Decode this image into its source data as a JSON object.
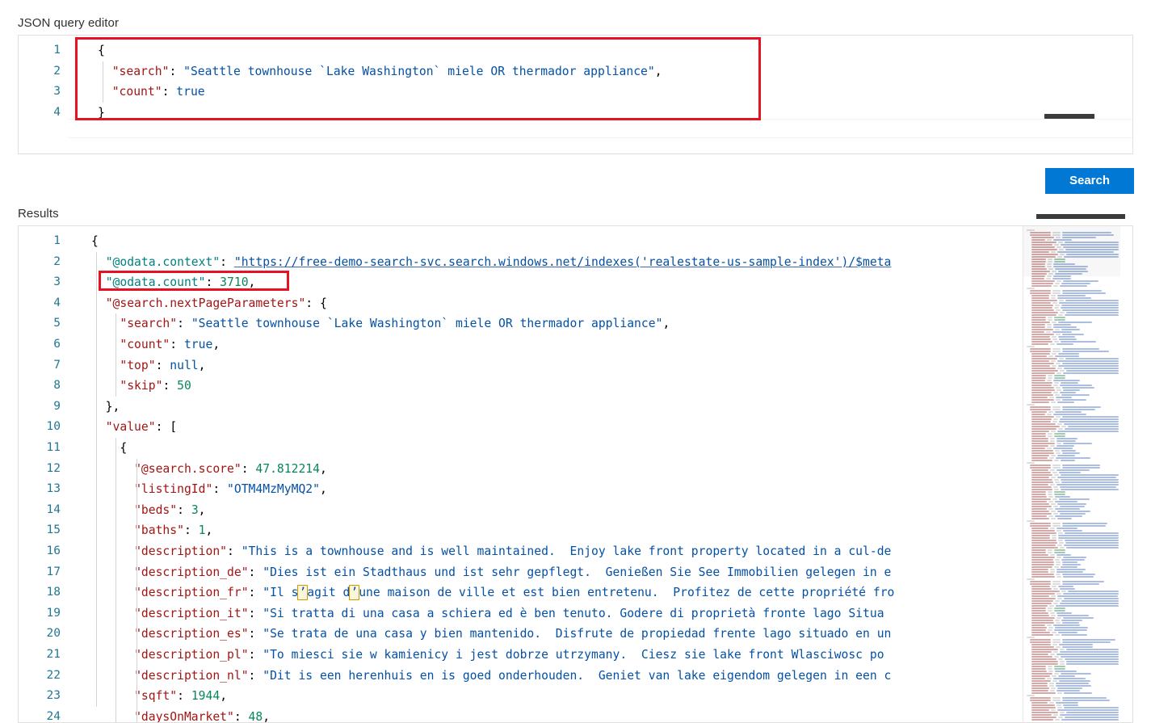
{
  "labels": {
    "json_query_editor": "JSON query editor",
    "results": "Results"
  },
  "actions": {
    "search_button": "Search"
  },
  "colors": {
    "accent": "#0078d4",
    "annotation": "#e81123",
    "line_number": "#237893",
    "json_key": "#a31515",
    "json_string": "#0451a5",
    "json_number": "#098658",
    "json_odata_key": "#008080"
  },
  "query_editor": {
    "line_numbers": [
      "1",
      "2",
      "3",
      "4"
    ],
    "lines": [
      [
        {
          "text": "{",
          "cls": "t-punc"
        }
      ],
      [
        {
          "text": "  ",
          "cls": "t-punc"
        },
        {
          "text": "\"search\"",
          "cls": "t-key"
        },
        {
          "text": ": ",
          "cls": "t-punc"
        },
        {
          "text": "\"Seattle townhouse `Lake Washington` miele OR thermador appliance\"",
          "cls": "t-str"
        },
        {
          "text": ",",
          "cls": "t-punc"
        }
      ],
      [
        {
          "text": "  ",
          "cls": "t-punc"
        },
        {
          "text": "\"count\"",
          "cls": "t-key"
        },
        {
          "text": ": ",
          "cls": "t-punc"
        },
        {
          "text": "true",
          "cls": "t-kw"
        }
      ],
      [
        {
          "text": "}",
          "cls": "t-punc"
        }
      ]
    ],
    "search_value": "Seattle townhouse `Lake Washington` miele OR thermador appliance",
    "count_value": "true"
  },
  "results_editor": {
    "line_numbers": [
      "1",
      "2",
      "3",
      "4",
      "5",
      "6",
      "7",
      "8",
      "9",
      "10",
      "11",
      "12",
      "13",
      "14",
      "15",
      "16",
      "17",
      "18",
      "19",
      "20",
      "21",
      "22",
      "23",
      "24"
    ],
    "lines": [
      [
        {
          "text": "{",
          "cls": "t-punc"
        }
      ],
      [
        {
          "text": "  ",
          "cls": "t-punc"
        },
        {
          "text": "\"@odata.context\"",
          "cls": "t-teal"
        },
        {
          "text": ": ",
          "cls": "t-punc"
        },
        {
          "text": "\"https://free-demo-search-svc.search.windows.net/indexes('realestate-us-sample-index')/$meta",
          "cls": "t-link"
        }
      ],
      [
        {
          "text": "  ",
          "cls": "t-punc"
        },
        {
          "text": "\"@odata.count\"",
          "cls": "t-teal"
        },
        {
          "text": ": ",
          "cls": "t-punc"
        },
        {
          "text": "3710",
          "cls": "t-num"
        },
        {
          "text": ",",
          "cls": "t-punc"
        }
      ],
      [
        {
          "text": "  ",
          "cls": "t-punc"
        },
        {
          "text": "\"@search.nextPageParameters\"",
          "cls": "t-key"
        },
        {
          "text": ": {",
          "cls": "t-punc"
        }
      ],
      [
        {
          "text": "    ",
          "cls": "t-punc"
        },
        {
          "text": "\"search\"",
          "cls": "t-key"
        },
        {
          "text": ": ",
          "cls": "t-punc"
        },
        {
          "text": "\"Seattle townhouse `Lake Washington` miele OR thermador appliance\"",
          "cls": "t-str"
        },
        {
          "text": ",",
          "cls": "t-punc"
        }
      ],
      [
        {
          "text": "    ",
          "cls": "t-punc"
        },
        {
          "text": "\"count\"",
          "cls": "t-key"
        },
        {
          "text": ": ",
          "cls": "t-punc"
        },
        {
          "text": "true",
          "cls": "t-kw"
        },
        {
          "text": ",",
          "cls": "t-punc"
        }
      ],
      [
        {
          "text": "    ",
          "cls": "t-punc"
        },
        {
          "text": "\"top\"",
          "cls": "t-key"
        },
        {
          "text": ": ",
          "cls": "t-punc"
        },
        {
          "text": "null",
          "cls": "t-kw"
        },
        {
          "text": ",",
          "cls": "t-punc"
        }
      ],
      [
        {
          "text": "    ",
          "cls": "t-punc"
        },
        {
          "text": "\"skip\"",
          "cls": "t-key"
        },
        {
          "text": ": ",
          "cls": "t-punc"
        },
        {
          "text": "50",
          "cls": "t-num"
        }
      ],
      [
        {
          "text": "  },",
          "cls": "t-punc"
        }
      ],
      [
        {
          "text": "  ",
          "cls": "t-punc"
        },
        {
          "text": "\"value\"",
          "cls": "t-key"
        },
        {
          "text": ": [",
          "cls": "t-punc"
        }
      ],
      [
        {
          "text": "    {",
          "cls": "t-punc"
        }
      ],
      [
        {
          "text": "      ",
          "cls": "t-punc"
        },
        {
          "text": "\"@search.score\"",
          "cls": "t-key"
        },
        {
          "text": ": ",
          "cls": "t-punc"
        },
        {
          "text": "47.812214",
          "cls": "t-num"
        },
        {
          "text": ",",
          "cls": "t-punc"
        }
      ],
      [
        {
          "text": "      ",
          "cls": "t-punc"
        },
        {
          "text": "\"listingId\"",
          "cls": "t-key"
        },
        {
          "text": ": ",
          "cls": "t-punc"
        },
        {
          "text": "\"OTM4MzMyMQ2\"",
          "cls": "t-str"
        },
        {
          "text": ",",
          "cls": "t-punc"
        }
      ],
      [
        {
          "text": "      ",
          "cls": "t-punc"
        },
        {
          "text": "\"beds\"",
          "cls": "t-key"
        },
        {
          "text": ": ",
          "cls": "t-punc"
        },
        {
          "text": "3",
          "cls": "t-num"
        },
        {
          "text": ",",
          "cls": "t-punc"
        }
      ],
      [
        {
          "text": "      ",
          "cls": "t-punc"
        },
        {
          "text": "\"baths\"",
          "cls": "t-key"
        },
        {
          "text": ": ",
          "cls": "t-punc"
        },
        {
          "text": "1",
          "cls": "t-num"
        },
        {
          "text": ",",
          "cls": "t-punc"
        }
      ],
      [
        {
          "text": "      ",
          "cls": "t-punc"
        },
        {
          "text": "\"description\"",
          "cls": "t-key"
        },
        {
          "text": ": ",
          "cls": "t-punc"
        },
        {
          "text": "\"This is a townhouse and is well maintained.  Enjoy lake front property located in a cul-de",
          "cls": "t-str"
        }
      ],
      [
        {
          "text": "      ",
          "cls": "t-punc"
        },
        {
          "text": "\"description_de\"",
          "cls": "t-key"
        },
        {
          "text": ": ",
          "cls": "t-punc"
        },
        {
          "text": "\"Dies ist ein Stadthaus und ist sehr gepflegt.  Genießen Sie See Immobilien gelegen in e",
          "cls": "t-str"
        }
      ],
      [
        {
          "text": "      ",
          "cls": "t-punc"
        },
        {
          "text": "\"description_fr\"",
          "cls": "t-key"
        },
        {
          "text": ": ",
          "cls": "t-punc"
        },
        {
          "text": "\"Il s",
          "cls": "t-str"
        },
        {
          "text": "’",
          "cls": "t-special"
        },
        {
          "text": "agit d",
          "cls": "t-str"
        },
        {
          "text": "’",
          "cls": "t-special"
        },
        {
          "text": "une maison de ville et est bien entretenu.  Profitez de cette propriété fro",
          "cls": "t-str"
        }
      ],
      [
        {
          "text": "      ",
          "cls": "t-punc"
        },
        {
          "text": "\"description_it\"",
          "cls": "t-key"
        },
        {
          "text": ": ",
          "cls": "t-punc"
        },
        {
          "text": "\"Si tratta di una casa a schiera ed è ben tenuto. Godere di proprietà fronte lago Situa",
          "cls": "t-str"
        }
      ],
      [
        {
          "text": "      ",
          "cls": "t-punc"
        },
        {
          "text": "\"description_es\"",
          "cls": "t-key"
        },
        {
          "text": ": ",
          "cls": "t-punc"
        },
        {
          "text": "\"Se trata de una casa y bien mantenido.  Disfrute de propiedad frente lago situado en un",
          "cls": "t-str"
        }
      ],
      [
        {
          "text": "      ",
          "cls": "t-punc"
        },
        {
          "text": "\"description_pl\"",
          "cls": "t-key"
        },
        {
          "text": ": ",
          "cls": "t-punc"
        },
        {
          "text": "\"To miesci sie w kamienicy i jest dobrze utrzymany.  Ciesz sie lake front Wlasciwosc po",
          "cls": "t-str"
        }
      ],
      [
        {
          "text": "      ",
          "cls": "t-punc"
        },
        {
          "text": "\"description_nl\"",
          "cls": "t-key"
        },
        {
          "text": ": ",
          "cls": "t-punc"
        },
        {
          "text": "\"Dit is een herenhuis en is goed onderhouden.  Geniet van lake eigendom gelegen in een c",
          "cls": "t-str"
        }
      ],
      [
        {
          "text": "      ",
          "cls": "t-punc"
        },
        {
          "text": "\"sqft\"",
          "cls": "t-key"
        },
        {
          "text": ": ",
          "cls": "t-punc"
        },
        {
          "text": "1944",
          "cls": "t-num"
        },
        {
          "text": ",",
          "cls": "t-punc"
        }
      ],
      [
        {
          "text": "      ",
          "cls": "t-punc"
        },
        {
          "text": "\"daysOnMarket\"",
          "cls": "t-key"
        },
        {
          "text": ": ",
          "cls": "t-punc"
        },
        {
          "text": "48",
          "cls": "t-num"
        },
        {
          "text": ",",
          "cls": "t-punc"
        }
      ]
    ],
    "values": {
      "odata_count": "3710",
      "skip": "50",
      "top": "null",
      "count": "true",
      "search_score": "47.812214",
      "listing_id": "OTM4MzMyMQ2",
      "beds": "3",
      "baths": "1",
      "sqft": "1944",
      "days_on_market": "48"
    }
  },
  "annotations": [
    {
      "name": "query-highlight",
      "target": "search and count query lines"
    },
    {
      "name": "count-highlight",
      "target": "@odata.count 3710"
    }
  ]
}
